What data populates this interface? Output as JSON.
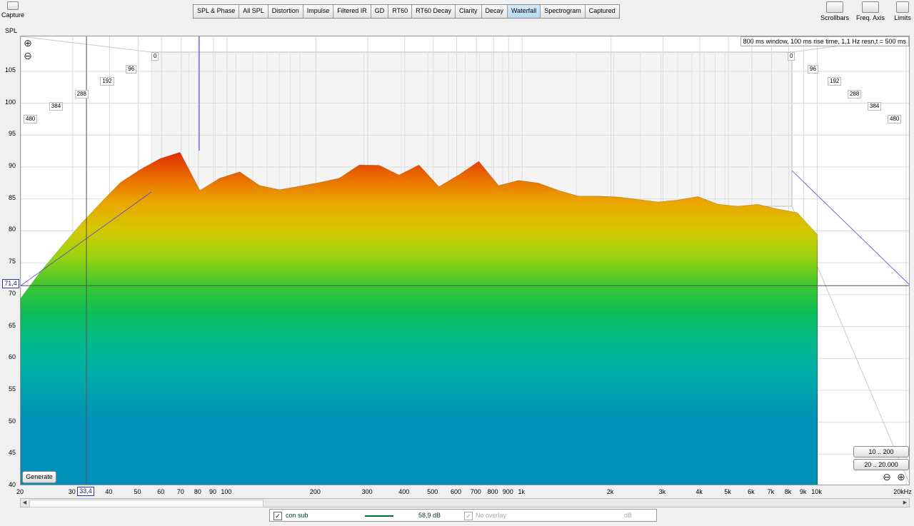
{
  "toolbar": {
    "capture_label": "Capture",
    "tabs": [
      "SPL & Phase",
      "All SPL",
      "Distortion",
      "Impulse",
      "Filtered IR",
      "GD",
      "RT60",
      "RT60 Decay",
      "Clarity",
      "Decay",
      "Waterfall",
      "Spectrogram",
      "Captured"
    ],
    "active_tab": "Waterfall",
    "right_buttons": [
      "Scrollbars",
      "Freq. Axis",
      "Limits"
    ]
  },
  "plot": {
    "y_axis_title": "SPL",
    "info_text": "800 ms window, 100 ms rise time,  1,1 Hz resn,t = 500 ms",
    "cursor_y": "71,4",
    "cursor_x": "33,4",
    "time_labels": [
      "0",
      "96",
      "192",
      "288",
      "384",
      "480"
    ],
    "range_buttons": [
      "10 .. 200",
      "20 .. 20.000"
    ],
    "generate_label": "Generate"
  },
  "chart_data": {
    "type": "area",
    "title": "",
    "xlabel": "",
    "ylabel": "SPL",
    "x_scale": "log",
    "xlim": [
      20,
      20000
    ],
    "ylim": [
      40,
      108
    ],
    "x_ticks": [
      20,
      30,
      40,
      50,
      60,
      70,
      80,
      90,
      100,
      200,
      300,
      400,
      500,
      600,
      700,
      800,
      900,
      1000,
      2000,
      3000,
      4000,
      5000,
      6000,
      7000,
      8000,
      9000,
      10000,
      20000
    ],
    "x_tick_labels": [
      "20",
      "30",
      "40",
      "50",
      "60",
      "70",
      "80",
      "90",
      "100",
      "200",
      "300",
      "400",
      "500",
      "600",
      "700",
      "800",
      "900",
      "1k",
      "2k",
      "3k",
      "4k",
      "5k",
      "6k",
      "7k",
      "8k",
      "9k",
      "10k",
      "20kHz"
    ],
    "y_ticks": [
      40,
      45,
      50,
      55,
      60,
      65,
      70,
      75,
      80,
      85,
      90,
      95,
      100,
      105
    ],
    "time_axis_ms": [
      0,
      96,
      192,
      288,
      384,
      480
    ],
    "colormap": [
      "#0090b8",
      "#00b8a0",
      "#10c040",
      "#c8d800",
      "#f0a000",
      "#e02000"
    ],
    "front_slice": {
      "freq_hz": [
        20,
        25,
        30,
        35,
        40,
        45,
        50,
        55,
        60,
        65,
        70,
        75,
        80,
        90,
        100,
        120,
        150,
        200,
        250,
        300,
        350,
        400,
        450,
        500,
        600,
        700,
        800,
        900,
        1000,
        1500,
        2000,
        3000,
        4000,
        5000,
        6000,
        7000,
        8000,
        9000,
        10000
      ],
      "spl_db": [
        70,
        76,
        80,
        84,
        86,
        89,
        90,
        91,
        92,
        92,
        93,
        91,
        87,
        86,
        92,
        88,
        87,
        88,
        89,
        92,
        90,
        89,
        91,
        87,
        89,
        92,
        88,
        87,
        89,
        86,
        86,
        85,
        86,
        84,
        85,
        84,
        84,
        83,
        80
      ]
    },
    "slices": 120,
    "grid": true
  },
  "legend": {
    "checked": true,
    "name": "con sub",
    "line_color": "#007030",
    "value": "58,9 dB",
    "overlay_label": "No overlay",
    "overlay_unit": "dB"
  }
}
